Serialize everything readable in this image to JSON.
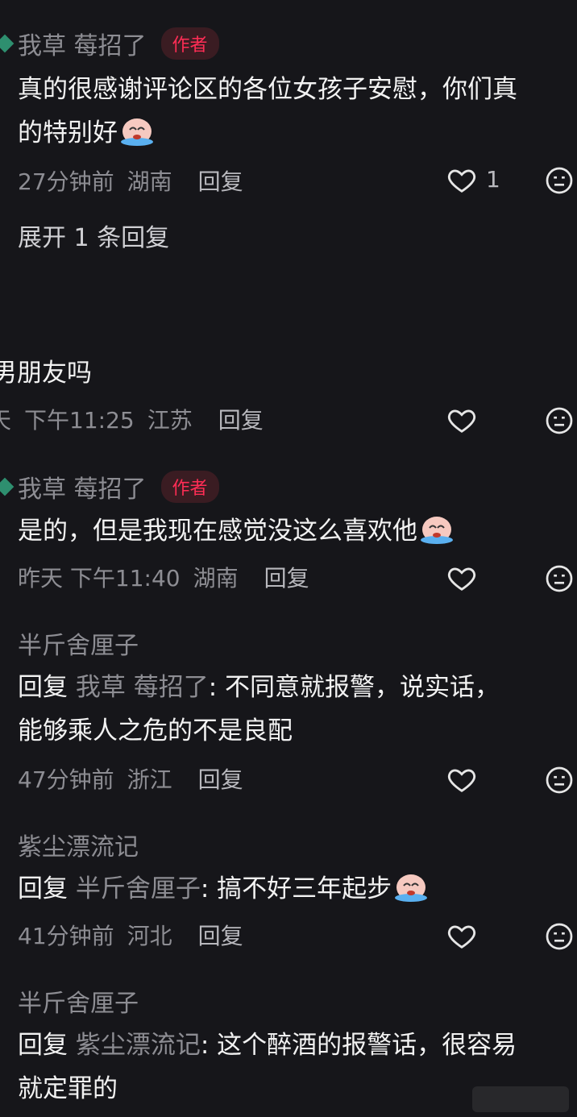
{
  "comments": [
    {
      "author": "我草 莓招了",
      "author_badge": "作者",
      "line1": "真的很感谢评论区的各位女孩子安慰，你们真",
      "line2": "的特别好",
      "time": "27分钟前",
      "location": "湖南",
      "reply_label": "回复",
      "like_count": "1"
    },
    {
      "text_fragment": "男朋友吗",
      "time_prefix": "天",
      "time": "下午11:25",
      "location": "江苏",
      "reply_label": "回复"
    },
    {
      "author": "我草 莓招了",
      "author_badge": "作者",
      "line1": "是的，但是我现在感觉没这么喜欢他",
      "time": "昨天 下午11:40",
      "location": "湖南",
      "reply_label": "回复"
    },
    {
      "author": "半斤舍厘子",
      "reply_prefix": "回复",
      "reply_to": "我草 莓招了",
      "line1": ": 不同意就报警，说实话，",
      "line2": "能够乘人之危的不是良配",
      "time": "47分钟前",
      "location": "浙江",
      "reply_label": "回复"
    },
    {
      "author": "紫尘漂流记",
      "reply_prefix": "回复",
      "reply_to": "半斤舍厘子",
      "line1": ": 搞不好三年起步",
      "time": "41分钟前",
      "location": "河北",
      "reply_label": "回复"
    },
    {
      "author": "半斤舍厘子",
      "reply_prefix": "回复",
      "reply_to": "紫尘漂流记",
      "line1": ": 这个醉酒的报警话，很容易",
      "line2": "就定罪的"
    }
  ],
  "expand_replies": "展开 1 条回复",
  "icons": {
    "like": "heart-outline-icon",
    "dislike": "neutral-face-icon",
    "emoji": "crying-face-emoji"
  },
  "colors": {
    "background": "#16161a",
    "author_badge": "#ff2d55",
    "muted": "#8d8d93"
  }
}
